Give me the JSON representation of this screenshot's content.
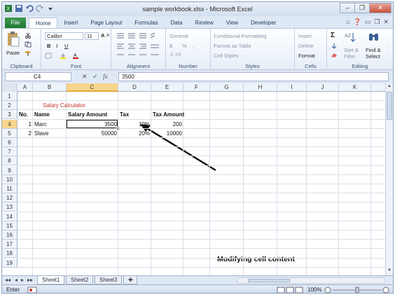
{
  "window": {
    "title": "sample workbook.xlsx - Microsoft Excel",
    "controls": {
      "minimize": "–",
      "restore": "❐",
      "close": "✕"
    }
  },
  "quick_access": [
    "save-icon",
    "undo-icon",
    "redo-icon"
  ],
  "tabs": [
    "File",
    "Home",
    "Insert",
    "Page Layout",
    "Formulas",
    "Data",
    "Review",
    "View",
    "Developer"
  ],
  "active_tab": "Home",
  "ribbon": {
    "clipboard": {
      "label": "Clipboard",
      "paste": "Paste"
    },
    "font": {
      "label": "Font",
      "font_name": "Calibri",
      "font_size": "11",
      "bold": "B",
      "italic": "I",
      "underline": "U",
      "grow": "A",
      "shrink": "A"
    },
    "alignment": {
      "label": "Alignment"
    },
    "number": {
      "label": "Number",
      "format": "General",
      "currency": "$",
      "percent": "%",
      "comma": ",",
      "inc_dec": ".0 .00"
    },
    "styles": {
      "label": "Styles",
      "conditional": "Conditional Formatting",
      "format_table": "Format as Table",
      "cell_styles": "Cell Styles"
    },
    "cells": {
      "label": "Cells",
      "insert": "Insert",
      "delete": "Delete",
      "format": "Format"
    },
    "editing": {
      "label": "Editing",
      "sum": "Σ",
      "sort_filter_1": "Sort &",
      "sort_filter_2": "Filter",
      "find_select_1": "Find &",
      "find_select_2": "Select"
    }
  },
  "formula_bar": {
    "name_box": "C4",
    "cancel": "✕",
    "enter": "✓",
    "fx": "fx",
    "value": "3500"
  },
  "columns": [
    "A",
    "B",
    "C",
    "D",
    "E",
    "F",
    "G",
    "H",
    "I",
    "J",
    "K"
  ],
  "selected_column": "C",
  "rows": [
    "1",
    "2",
    "3",
    "4",
    "5",
    "6",
    "7",
    "8",
    "9",
    "10",
    "11",
    "12",
    "13",
    "14",
    "15",
    "16",
    "17",
    "18",
    "19"
  ],
  "selected_row": "4",
  "cells": {
    "B2": "Salary Calculator",
    "A3": "No.",
    "B3": "Name",
    "C3": "Salary Amount",
    "D3": "Tax",
    "E3": "Tax Amount",
    "A4": "1",
    "B4": "Marc",
    "C4": "3500",
    "D4": "10%",
    "E4": "200",
    "A5": "2",
    "B5": "Stave",
    "C5": "50000",
    "D5": "20%",
    "E5": "10000"
  },
  "title_color": "#c0392b",
  "annotation": "Modifying cell content",
  "sheets": [
    "Sheet1",
    "Sheet2",
    "Sheet3"
  ],
  "active_sheet": "Sheet1",
  "status": {
    "mode": "Enter",
    "zoom": "100%"
  }
}
